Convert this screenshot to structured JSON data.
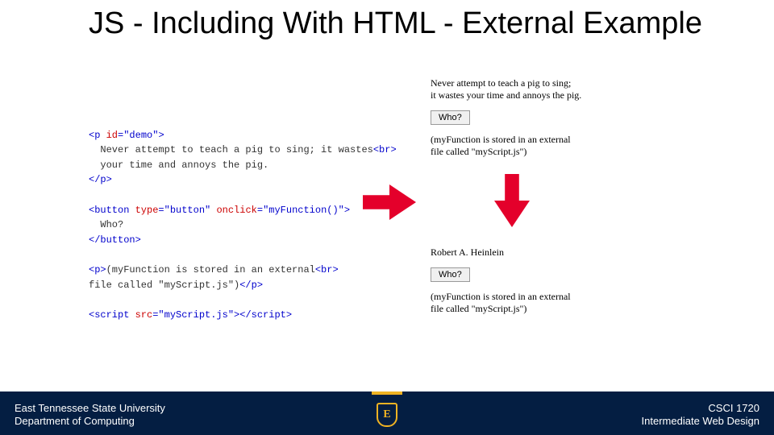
{
  "title": "JS - Including With HTML - External Example",
  "code": {
    "l1a": "<p ",
    "l1b": "id",
    "l1c": "=",
    "l1d": "\"demo\"",
    "l1e": ">",
    "l2": "  Never attempt to teach a pig to sing; it wastes",
    "l2b": "<br>",
    "l3": "  your time and annoys the pig.",
    "l4": "</p>",
    "l5a": "<button ",
    "l5b": "type",
    "l5c": "=",
    "l5d": "\"button\"",
    "l5e": " ",
    "l5f": "onclick",
    "l5g": "=",
    "l5h": "\"myFunction()\"",
    "l5i": ">",
    "l6": "  Who?",
    "l7": "</button>",
    "l8a": "<p>",
    "l8b": "(myFunction is stored in an external",
    "l8c": "<br>",
    "l9": "file called \"myScript.js\")",
    "l9b": "</p>",
    "l10a": "<script ",
    "l10b": "src",
    "l10c": "=",
    "l10d": "\"myScript.js\"",
    "l10e": "></",
    "l10f": "script",
    "l10g": ">"
  },
  "preview_before": {
    "line1": "Never attempt to teach a pig to sing;",
    "line2": "it wastes your time and annoys the pig.",
    "button": "Who?",
    "note1": "(myFunction is stored in an external",
    "note2": "file called \"myScript.js\")"
  },
  "preview_after": {
    "line1": "Robert A. Heinlein",
    "button": "Who?",
    "note1": "(myFunction is stored in an external",
    "note2": "file called \"myScript.js\")"
  },
  "footer": {
    "uni": "East Tennessee State University",
    "dept": "Department of Computing",
    "course": "CSCI 1720",
    "course_name": "Intermediate Web Design",
    "logo_letter": "E"
  },
  "colors": {
    "navy": "#041e42",
    "gold": "#f0b323",
    "arrow": "#e4002b"
  }
}
